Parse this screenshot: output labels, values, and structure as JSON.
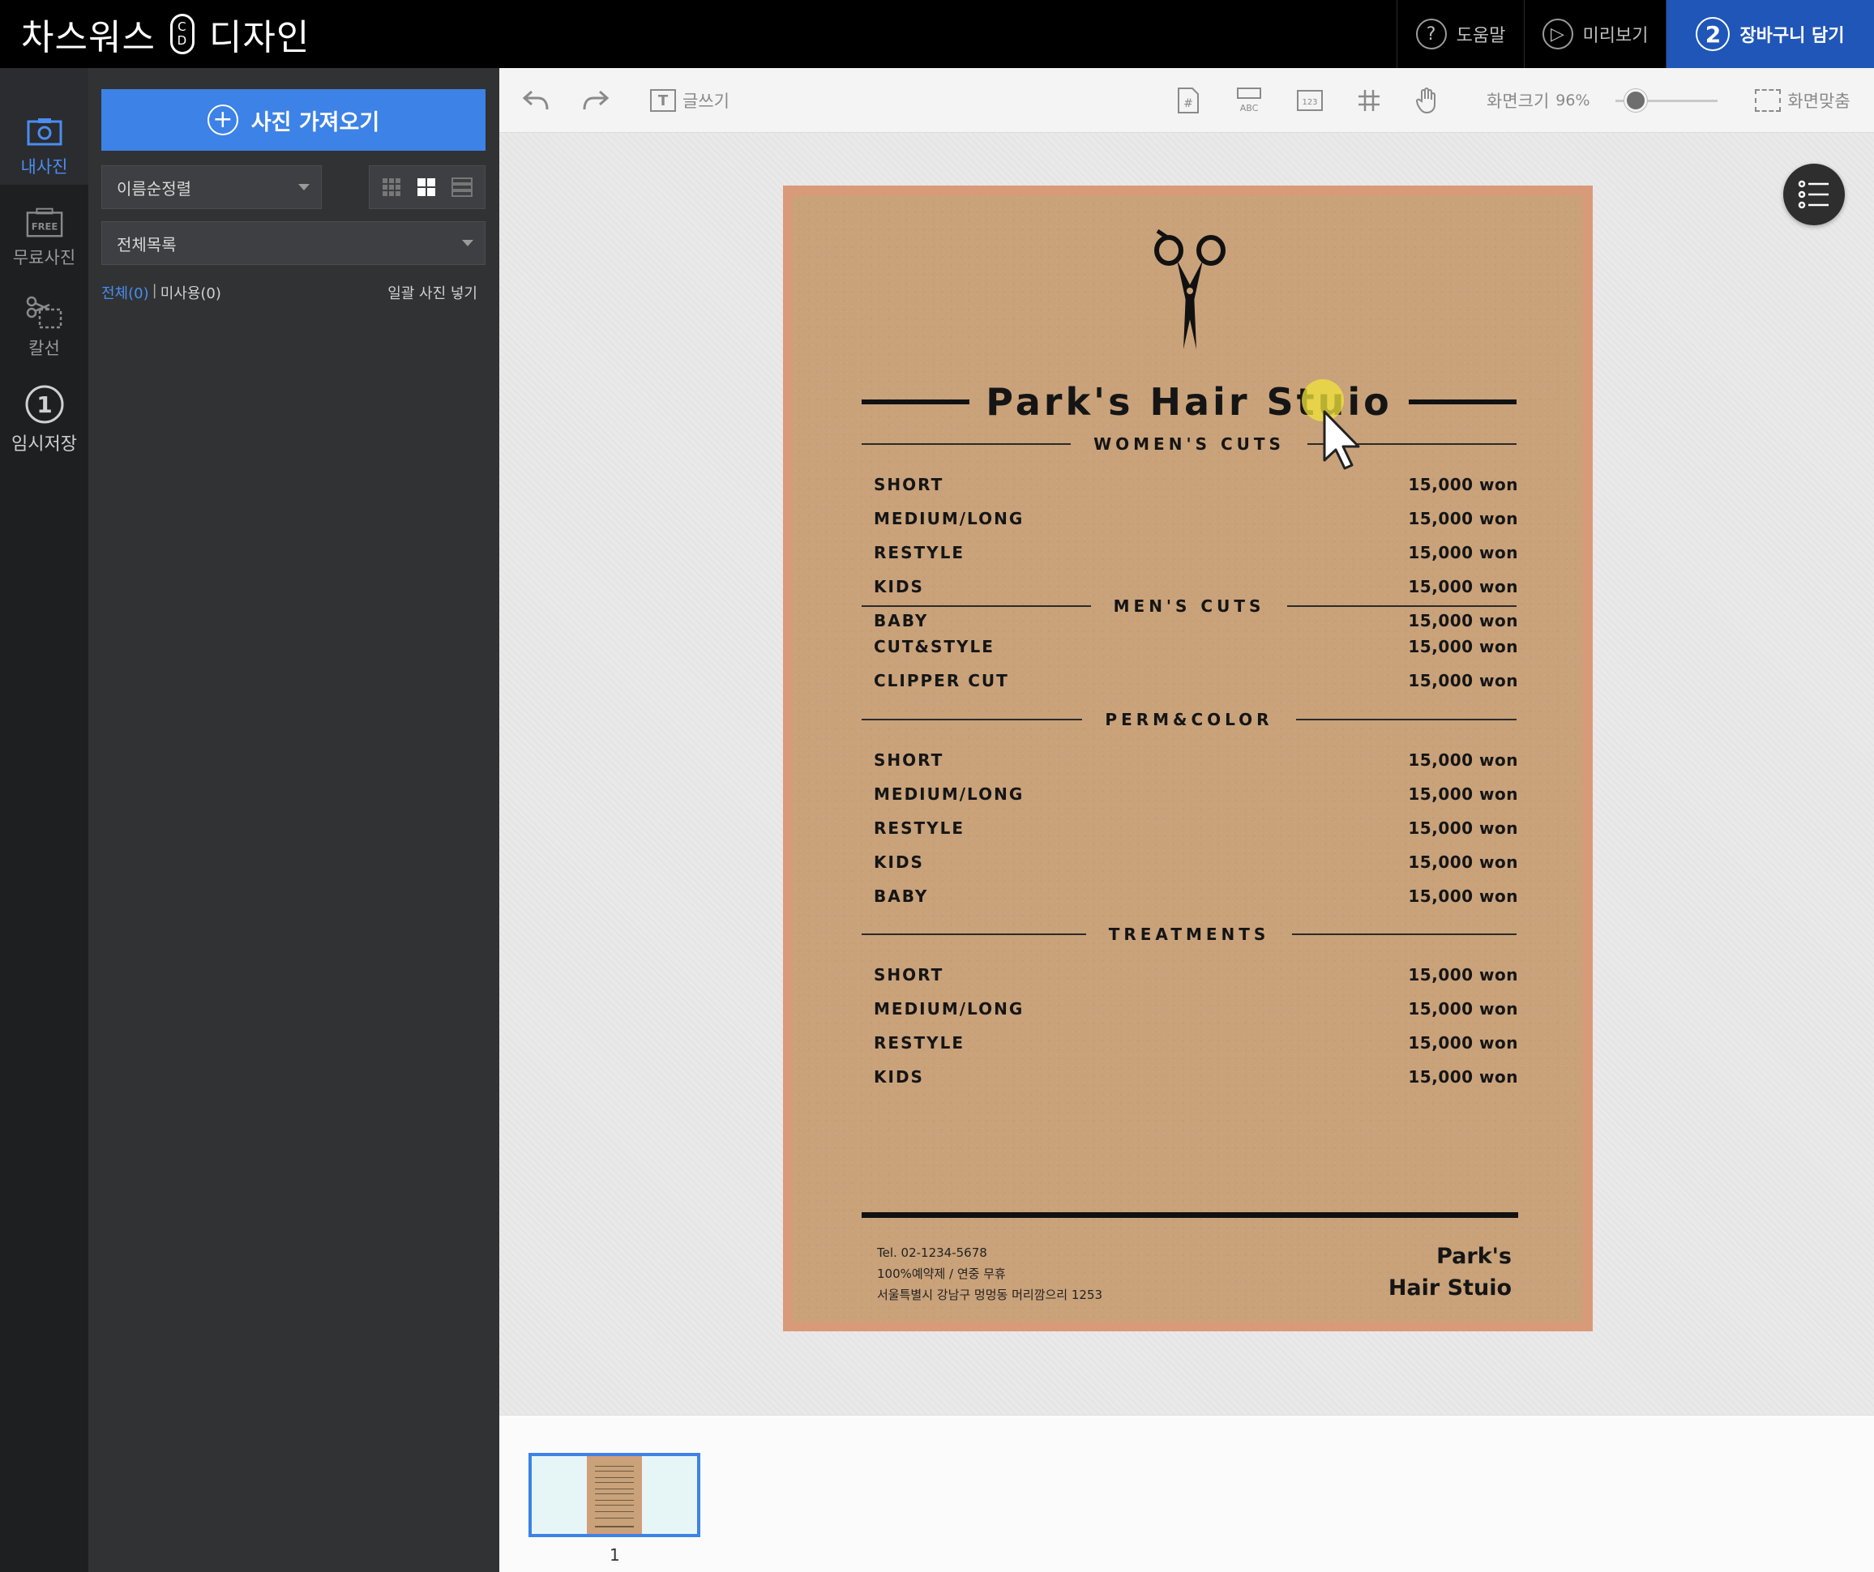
{
  "app": {
    "brand_left": "차스워스",
    "brand_logo_top": "C",
    "brand_logo_bottom": "D",
    "brand_right": "디자인"
  },
  "header": {
    "help_label": "도움말",
    "help_icon": "?",
    "preview_label": "미리보기",
    "preview_icon": "▷",
    "cart_step": "2",
    "cart_label": "장바구니 담기",
    "cart_color": "#1f56b8"
  },
  "rail": {
    "my_photos": "내사진",
    "free_photos": "무료사진",
    "free_badge": "FREE",
    "cut_line": "칼선",
    "temp_save_step": "1",
    "temp_save": "임시저장"
  },
  "panel": {
    "import_label": "사진 가져오기",
    "sort_value": "이름순정렬",
    "list_value": "전체목록",
    "filter_all": "전체(0)",
    "filter_sep": "|",
    "filter_unused": "미사용(0)",
    "bulk_insert": "일괄 사진 넣기",
    "accent_color": "#3d82e6"
  },
  "toolbar": {
    "text_icon": "T",
    "text_label": "글쓰기",
    "zoom_label": "화면크기",
    "zoom_value": "96%",
    "zoom_fraction": 0.2,
    "fit_label": "화면맞춤"
  },
  "document": {
    "title": "Park's Hair Stuio",
    "sections": [
      {
        "name": "WOMEN'S CUTS",
        "items": [
          {
            "name": "SHORT",
            "price": "15,000 won"
          },
          {
            "name": "MEDIUM/LONG",
            "price": "15,000 won"
          },
          {
            "name": "RESTYLE",
            "price": "15,000 won"
          },
          {
            "name": "KIDS",
            "price": "15,000 won"
          },
          {
            "name": "BABY",
            "price": "15,000 won"
          }
        ]
      },
      {
        "name": "MEN'S CUTS",
        "items": [
          {
            "name": "CUT&STYLE",
            "price": "15,000 won"
          },
          {
            "name": "CLIPPER CUT",
            "price": "15,000 won"
          }
        ]
      },
      {
        "name": "PERM&COLOR",
        "items": [
          {
            "name": "SHORT",
            "price": "15,000 won"
          },
          {
            "name": "MEDIUM/LONG",
            "price": "15,000 won"
          },
          {
            "name": "RESTYLE",
            "price": "15,000 won"
          },
          {
            "name": "KIDS",
            "price": "15,000 won"
          },
          {
            "name": "BABY",
            "price": "15,000 won"
          }
        ]
      },
      {
        "name": "TREATMENTS",
        "items": [
          {
            "name": "SHORT",
            "price": "15,000 won"
          },
          {
            "name": "MEDIUM/LONG",
            "price": "15,000 won"
          },
          {
            "name": "RESTYLE",
            "price": "15,000 won"
          },
          {
            "name": "KIDS",
            "price": "15,000 won"
          }
        ]
      }
    ],
    "tel": "Tel. 02-1234-5678",
    "reservation": "100%예약제 / 연중 무휴",
    "address": "서울특별시 강남구 멍멍동 머리깜으리 1253",
    "brand_line1": "Park's",
    "brand_line2": "Hair Stuio",
    "paper_color": "#c9a27a",
    "border_color": "#d99a7a"
  },
  "thumbnails": {
    "pages": [
      {
        "number": "1"
      }
    ]
  }
}
